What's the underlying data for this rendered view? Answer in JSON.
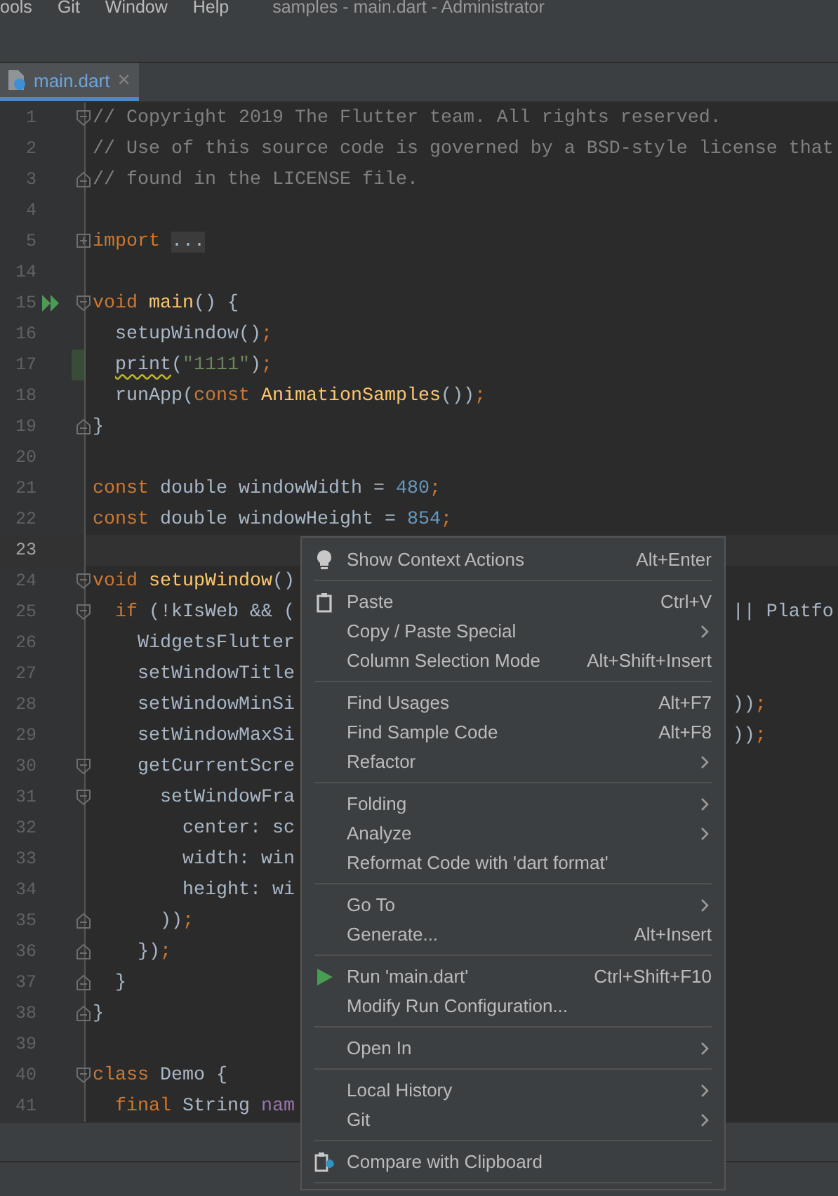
{
  "menu_bar": {
    "items": [
      "ools",
      "Git",
      "Window",
      "Help"
    ],
    "title": "samples - main.dart - Administrator"
  },
  "tabs": [
    {
      "label": "main.dart",
      "close": "✕",
      "selected": true
    }
  ],
  "editor": {
    "lines": [
      {
        "number": "1",
        "current": false,
        "fold_start": true,
        "fold_end": false,
        "collapsed": false,
        "runnable": false,
        "changed": false,
        "tokens": [
          {
            "kind": "comment",
            "text": "// Copyright 2019 The Flutter team. All rights reserved."
          }
        ]
      },
      {
        "number": "2",
        "current": false,
        "fold_start": false,
        "fold_end": false,
        "collapsed": false,
        "runnable": false,
        "changed": false,
        "tokens": [
          {
            "kind": "comment",
            "text": "// Use of this source code is governed by a BSD-style license that"
          }
        ]
      },
      {
        "number": "3",
        "current": false,
        "fold_start": false,
        "fold_end": true,
        "collapsed": false,
        "runnable": false,
        "changed": false,
        "tokens": [
          {
            "kind": "comment",
            "text": "// found in the LICENSE file."
          }
        ]
      },
      {
        "number": "4",
        "current": false,
        "fold_start": false,
        "fold_end": false,
        "collapsed": false,
        "runnable": false,
        "changed": false
      },
      {
        "number": "5",
        "current": false,
        "fold_start": false,
        "fold_end": false,
        "collapsed": true,
        "runnable": false,
        "changed": false,
        "tokens": [
          {
            "kind": "keyword",
            "text": "import "
          },
          {
            "kind": "folded",
            "text": "..."
          }
        ]
      },
      {
        "number": "14",
        "current": false,
        "fold_start": false,
        "fold_end": false,
        "collapsed": false,
        "runnable": false,
        "changed": false
      },
      {
        "number": "15",
        "current": false,
        "fold_start": true,
        "fold_end": false,
        "collapsed": false,
        "runnable": true,
        "changed": false,
        "tokens": [
          {
            "kind": "keyword",
            "text": "void "
          },
          {
            "kind": "function",
            "text": "main"
          },
          {
            "kind": "plain",
            "text": "() {"
          }
        ]
      },
      {
        "number": "16",
        "current": false,
        "fold_start": false,
        "fold_end": false,
        "collapsed": false,
        "runnable": false,
        "changed": false,
        "tokens": [
          {
            "kind": "plain",
            "text": "  setupWindow()"
          },
          {
            "kind": "keyword",
            "text": ";"
          }
        ]
      },
      {
        "number": "17",
        "current": false,
        "fold_start": false,
        "fold_end": false,
        "collapsed": false,
        "runnable": false,
        "changed": true,
        "tokens": [
          {
            "kind": "warning",
            "text": "  print"
          },
          {
            "kind": "plain",
            "text": "("
          },
          {
            "kind": "string",
            "text": "\"1111\""
          },
          {
            "kind": "plain",
            "text": ")"
          },
          {
            "kind": "keyword",
            "text": ";"
          }
        ]
      },
      {
        "number": "18",
        "current": false,
        "fold_start": false,
        "fold_end": false,
        "collapsed": false,
        "runnable": false,
        "changed": false,
        "tokens": [
          {
            "kind": "plain",
            "text": "  runApp("
          },
          {
            "kind": "keyword",
            "text": "const "
          },
          {
            "kind": "function",
            "text": "AnimationSamples"
          },
          {
            "kind": "plain",
            "text": "())"
          },
          {
            "kind": "keyword",
            "text": ";"
          }
        ]
      },
      {
        "number": "19",
        "current": false,
        "fold_start": false,
        "fold_end": true,
        "collapsed": false,
        "runnable": false,
        "changed": false,
        "tokens": [
          {
            "kind": "plain",
            "text": "}"
          }
        ]
      },
      {
        "number": "20",
        "current": false,
        "fold_start": false,
        "fold_end": false,
        "collapsed": false,
        "runnable": false,
        "changed": false
      },
      {
        "number": "21",
        "current": false,
        "fold_start": false,
        "fold_end": false,
        "collapsed": false,
        "runnable": false,
        "changed": false,
        "tokens": [
          {
            "kind": "keyword",
            "text": "const "
          },
          {
            "kind": "plain",
            "text": "double windowWidth = "
          },
          {
            "kind": "number",
            "text": "480"
          },
          {
            "kind": "keyword",
            "text": ";"
          }
        ]
      },
      {
        "number": "22",
        "current": false,
        "fold_start": false,
        "fold_end": false,
        "collapsed": false,
        "runnable": false,
        "changed": false,
        "tokens": [
          {
            "kind": "keyword",
            "text": "const "
          },
          {
            "kind": "plain",
            "text": "double windowHeight = "
          },
          {
            "kind": "number",
            "text": "854"
          },
          {
            "kind": "keyword",
            "text": ";"
          }
        ]
      },
      {
        "number": "23",
        "current": true,
        "fold_start": false,
        "fold_end": false,
        "collapsed": false,
        "runnable": false,
        "changed": false
      },
      {
        "number": "24",
        "current": false,
        "fold_start": true,
        "fold_end": false,
        "collapsed": false,
        "runnable": false,
        "changed": false,
        "tokens": [
          {
            "kind": "keyword",
            "text": "void "
          },
          {
            "kind": "function",
            "text": "setupWindow"
          },
          {
            "kind": "plain",
            "text": "()"
          }
        ]
      },
      {
        "number": "25",
        "current": false,
        "fold_start": true,
        "fold_end": false,
        "collapsed": false,
        "runnable": false,
        "changed": false,
        "tokens": [
          {
            "kind": "keyword",
            "text": "  if"
          },
          {
            "kind": "plain",
            "text": " (!kIsWeb && ("
          }
        ],
        "right": [
          {
            "kind": "plain",
            "text": "|| Platfo"
          }
        ]
      },
      {
        "number": "26",
        "current": false,
        "fold_start": false,
        "fold_end": false,
        "collapsed": false,
        "runnable": false,
        "changed": false,
        "tokens": [
          {
            "kind": "plain",
            "text": "    WidgetsFlutter"
          }
        ]
      },
      {
        "number": "27",
        "current": false,
        "fold_start": false,
        "fold_end": false,
        "collapsed": false,
        "runnable": false,
        "changed": false,
        "tokens": [
          {
            "kind": "plain",
            "text": "    setWindowTitle"
          }
        ]
      },
      {
        "number": "28",
        "current": false,
        "fold_start": false,
        "fold_end": false,
        "collapsed": false,
        "runnable": false,
        "changed": false,
        "tokens": [
          {
            "kind": "plain",
            "text": "    setWindowMinSi"
          }
        ],
        "right": [
          {
            "kind": "plain",
            "text": "))"
          },
          {
            "kind": "keyword",
            "text": ";"
          }
        ]
      },
      {
        "number": "29",
        "current": false,
        "fold_start": false,
        "fold_end": false,
        "collapsed": false,
        "runnable": false,
        "changed": false,
        "tokens": [
          {
            "kind": "plain",
            "text": "    setWindowMaxSi"
          }
        ],
        "right": [
          {
            "kind": "plain",
            "text": "))"
          },
          {
            "kind": "keyword",
            "text": ";"
          }
        ]
      },
      {
        "number": "30",
        "current": false,
        "fold_start": true,
        "fold_end": false,
        "collapsed": false,
        "runnable": false,
        "changed": false,
        "tokens": [
          {
            "kind": "plain",
            "text": "    getCurrentScre"
          }
        ]
      },
      {
        "number": "31",
        "current": false,
        "fold_start": true,
        "fold_end": false,
        "collapsed": false,
        "runnable": false,
        "changed": false,
        "tokens": [
          {
            "kind": "plain",
            "text": "      setWindowFra"
          }
        ]
      },
      {
        "number": "32",
        "current": false,
        "fold_start": false,
        "fold_end": false,
        "collapsed": false,
        "runnable": false,
        "changed": false,
        "tokens": [
          {
            "kind": "plain",
            "text": "        center: sc"
          }
        ]
      },
      {
        "number": "33",
        "current": false,
        "fold_start": false,
        "fold_end": false,
        "collapsed": false,
        "runnable": false,
        "changed": false,
        "tokens": [
          {
            "kind": "plain",
            "text": "        width: win"
          }
        ]
      },
      {
        "number": "34",
        "current": false,
        "fold_start": false,
        "fold_end": false,
        "collapsed": false,
        "runnable": false,
        "changed": false,
        "tokens": [
          {
            "kind": "plain",
            "text": "        height: wi"
          }
        ]
      },
      {
        "number": "35",
        "current": false,
        "fold_start": false,
        "fold_end": true,
        "collapsed": false,
        "runnable": false,
        "changed": false,
        "tokens": [
          {
            "kind": "plain",
            "text": "      ))"
          },
          {
            "kind": "keyword",
            "text": ";"
          }
        ]
      },
      {
        "number": "36",
        "current": false,
        "fold_start": false,
        "fold_end": true,
        "collapsed": false,
        "runnable": false,
        "changed": false,
        "tokens": [
          {
            "kind": "plain",
            "text": "    })"
          },
          {
            "kind": "keyword",
            "text": ";"
          }
        ]
      },
      {
        "number": "37",
        "current": false,
        "fold_start": false,
        "fold_end": true,
        "collapsed": false,
        "runnable": false,
        "changed": false,
        "tokens": [
          {
            "kind": "plain",
            "text": "  }"
          }
        ]
      },
      {
        "number": "38",
        "current": false,
        "fold_start": false,
        "fold_end": true,
        "collapsed": false,
        "runnable": false,
        "changed": false,
        "tokens": [
          {
            "kind": "plain",
            "text": "}"
          }
        ]
      },
      {
        "number": "39",
        "current": false,
        "fold_start": false,
        "fold_end": false,
        "collapsed": false,
        "runnable": false,
        "changed": false
      },
      {
        "number": "40",
        "current": false,
        "fold_start": true,
        "fold_end": false,
        "collapsed": false,
        "runnable": false,
        "changed": false,
        "tokens": [
          {
            "kind": "keyword",
            "text": "class "
          },
          {
            "kind": "plain",
            "text": "Demo {"
          }
        ]
      },
      {
        "number": "41",
        "current": false,
        "fold_start": false,
        "fold_end": false,
        "collapsed": false,
        "runnable": false,
        "changed": false,
        "tokens": [
          {
            "kind": "keyword",
            "text": "  final "
          },
          {
            "kind": "plain",
            "text": "String "
          },
          {
            "kind": "field",
            "text": "nam"
          }
        ]
      }
    ]
  },
  "context_menu": {
    "items": [
      {
        "kind": "intention",
        "label": "Show Context Actions",
        "shortcut": "Alt+Enter",
        "submenu": false
      },
      {
        "kind": "separator"
      },
      {
        "kind": "paste",
        "label": "Paste",
        "shortcut": "Ctrl+V",
        "submenu": false
      },
      {
        "kind": "item",
        "label": "Copy / Paste Special",
        "submenu": true
      },
      {
        "kind": "item",
        "label": "Column Selection Mode",
        "shortcut": "Alt+Shift+Insert",
        "submenu": false
      },
      {
        "kind": "separator"
      },
      {
        "kind": "item",
        "label": "Find Usages",
        "shortcut": "Alt+F7",
        "submenu": false
      },
      {
        "kind": "item",
        "label": "Find Sample Code",
        "shortcut": "Alt+F8",
        "submenu": false
      },
      {
        "kind": "item",
        "label": "Refactor",
        "submenu": true
      },
      {
        "kind": "separator"
      },
      {
        "kind": "item",
        "label": "Folding",
        "submenu": true
      },
      {
        "kind": "item",
        "label": "Analyze",
        "submenu": true
      },
      {
        "kind": "item",
        "label": "Reformat Code with 'dart format'",
        "submenu": false
      },
      {
        "kind": "separator"
      },
      {
        "kind": "item",
        "label": "Go To",
        "submenu": true
      },
      {
        "kind": "item",
        "label": "Generate...",
        "shortcut": "Alt+Insert",
        "submenu": false
      },
      {
        "kind": "separator"
      },
      {
        "kind": "run",
        "label": "Run 'main.dart'",
        "shortcut": "Ctrl+Shift+F10",
        "submenu": false
      },
      {
        "kind": "item",
        "label": "Modify Run Configuration...",
        "submenu": false
      },
      {
        "kind": "separator"
      },
      {
        "kind": "item",
        "label": "Open In",
        "submenu": true
      },
      {
        "kind": "separator"
      },
      {
        "kind": "item",
        "label": "Local History",
        "submenu": true
      },
      {
        "kind": "item",
        "label": "Git",
        "submenu": true
      },
      {
        "kind": "separator"
      },
      {
        "kind": "compare",
        "label": "Compare with Clipboard",
        "submenu": false
      },
      {
        "kind": "separator"
      }
    ]
  }
}
